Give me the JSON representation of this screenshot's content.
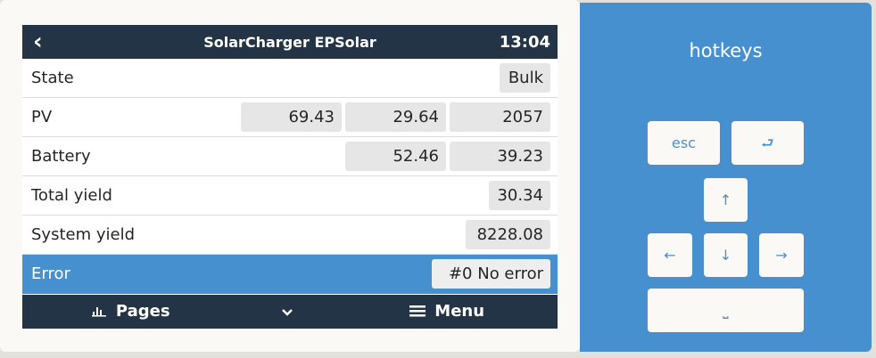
{
  "header": {
    "back_icon": "chevron-left-icon",
    "back_glyph": "‹",
    "title": "SolarCharger EPSolar",
    "time": "13:04"
  },
  "rows": [
    {
      "label": "State",
      "values": [
        "Bulk"
      ]
    },
    {
      "label": "PV",
      "values": [
        "69.43",
        "29.64",
        "2057"
      ]
    },
    {
      "label": "Battery",
      "values": [
        "52.46",
        "39.23"
      ]
    },
    {
      "label": "Total yield",
      "values": [
        "30.34"
      ]
    },
    {
      "label": "System yield",
      "values": [
        "8228.08"
      ]
    },
    {
      "label": "Error",
      "values": [
        "#0 No error"
      ]
    }
  ],
  "footer": {
    "pages_icon": "bar-chart-icon",
    "pages_label": "Pages",
    "chevron_icon": "chevron-down-icon",
    "menu_icon": "hamburger-icon",
    "menu_label": "Menu"
  },
  "hotkeys": {
    "title": "hotkeys",
    "esc": "esc",
    "enter_glyph": "⮐",
    "up_glyph": "↑",
    "left_glyph": "←",
    "down_glyph": "↓",
    "right_glyph": "→",
    "space_glyph": "⎵"
  },
  "colors": {
    "header_bg": "#233446",
    "accent": "#4790d0",
    "value_box": "#e6e6e6"
  }
}
